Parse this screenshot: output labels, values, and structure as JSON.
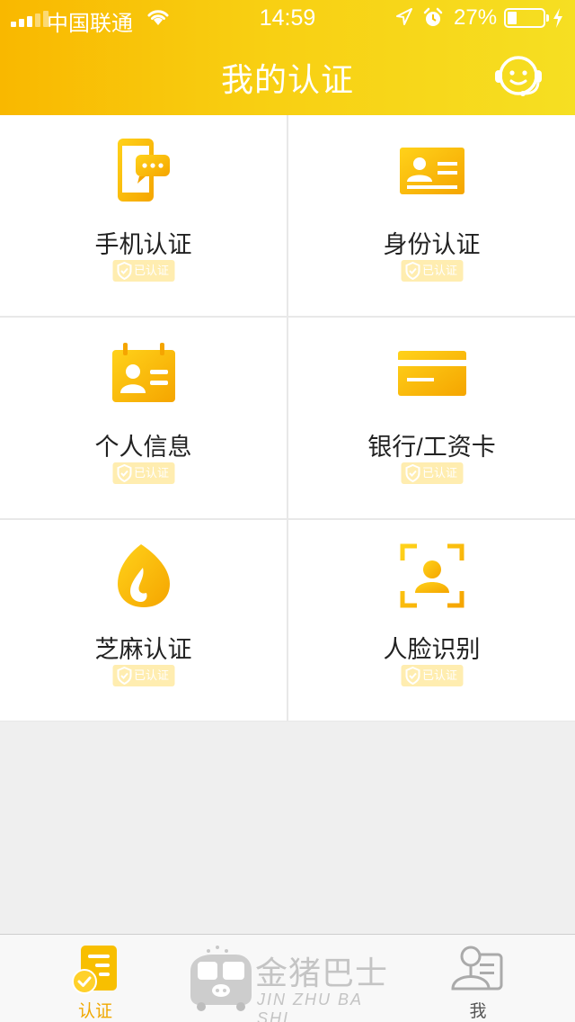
{
  "status_bar": {
    "carrier": "中国联通",
    "time": "14:59",
    "battery_percent": "27%",
    "battery_level": 0.27,
    "signal_bars": 3
  },
  "header": {
    "title": "我的认证",
    "service_icon": "customer-service-icon"
  },
  "theme": {
    "accent": "#f8c400",
    "accent_dark": "#f5a300",
    "badge_bg": "#ffedb0"
  },
  "auth_items": [
    {
      "label": "手机认证",
      "status": "已认证",
      "icon": "phone-chat-icon"
    },
    {
      "label": "身份认证",
      "status": "已认证",
      "icon": "id-card-icon"
    },
    {
      "label": "个人信息",
      "status": "已认证",
      "icon": "contact-card-icon"
    },
    {
      "label": "银行/工资卡",
      "status": "已认证",
      "icon": "bank-card-icon"
    },
    {
      "label": "芝麻认证",
      "status": "已认证",
      "icon": "sesame-icon"
    },
    {
      "label": "人脸识别",
      "status": "已认证",
      "icon": "face-scan-icon"
    }
  ],
  "tabbar": {
    "tabs": [
      {
        "label": "认证",
        "icon": "certify-doc-icon",
        "active": true
      },
      {
        "label": "我",
        "icon": "profile-icon",
        "active": false
      }
    ],
    "logo": {
      "text": "金猪巴士",
      "pinyin": "JIN ZHU BA SHI",
      "icon": "pig-bus-icon"
    }
  }
}
